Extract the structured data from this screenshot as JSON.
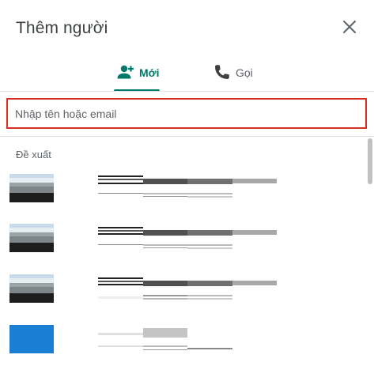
{
  "dialog": {
    "title": "Thêm người",
    "close_icon": "close-icon"
  },
  "tabs": [
    {
      "label": "Mới",
      "icon": "person-add-icon",
      "active": true
    },
    {
      "label": "Gọi",
      "icon": "phone-icon",
      "active": false
    }
  ],
  "search": {
    "placeholder": "Nhập tên hoặc email",
    "value": ""
  },
  "suggestions": {
    "label": "Đề xuất",
    "items": [
      {
        "avatar": "photo"
      },
      {
        "avatar": "photo"
      },
      {
        "avatar": "photo"
      },
      {
        "avatar": "blue"
      }
    ]
  },
  "colors": {
    "accent": "#00796b",
    "search_border": "#d93025",
    "avatar_blue": "#1a7fd4"
  }
}
